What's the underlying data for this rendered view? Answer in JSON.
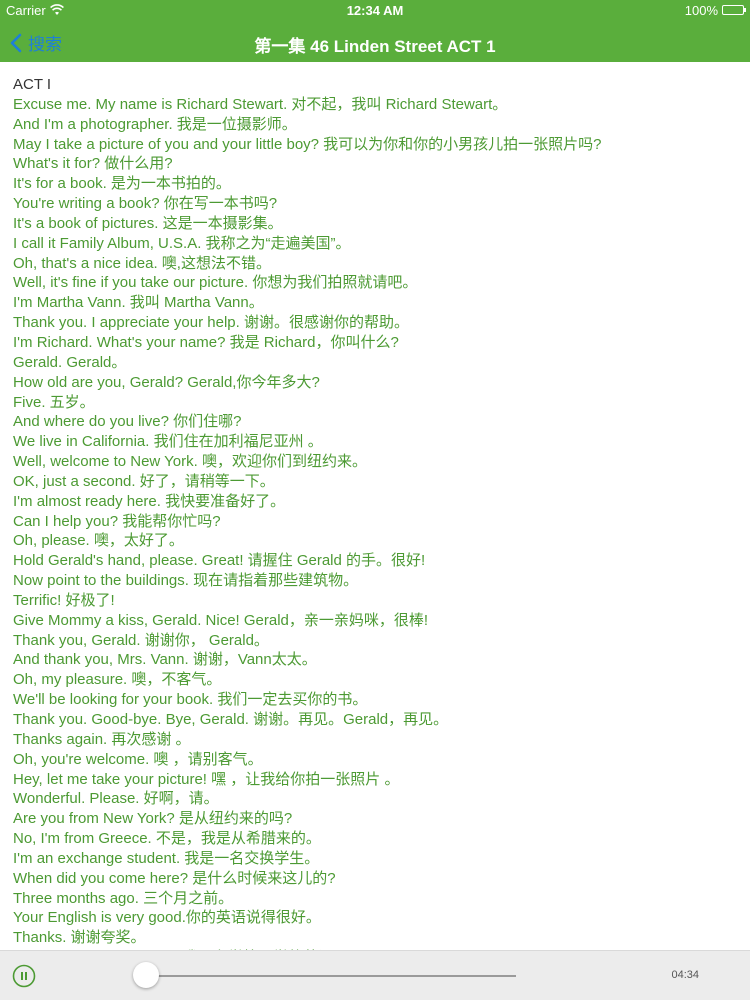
{
  "status_bar": {
    "carrier": "Carrier",
    "time": "12:34 AM",
    "battery": "100%"
  },
  "nav": {
    "back_label": "搜索",
    "title": "第一集 46 Linden Street ACT 1"
  },
  "script_lines": [
    "ACT I",
    "Excuse me. My name is Richard Stewart. 对不起，我叫 Richard Stewart。",
    "And I'm a photographer.  我是一位摄影师。",
    "May I take a picture of you and your little boy?  我可以为你和你的小男孩儿拍一张照片吗?",
    "What's it for?  做什么用?",
    "It's for a book.  是为一本书拍的。",
    "You're writing a book? 你在写一本书吗?",
    "It's a book of pictures. 这是一本摄影集。",
    "I call it Family Album, U.S.A.  我称之为“走遍美国”。",
    "Oh, that's a nice idea.  噢,这想法不错。",
    "Well, it's fine if you take our picture.  你想为我们拍照就请吧。",
    "I'm Martha Vann.  我叫 Martha Vann。",
    "Thank you. I appreciate your help.  谢谢。很感谢你的帮助。",
    "I'm Richard. What's your name?  我是 Richard，你叫什么?",
    "Gerald. Gerald。",
    "How old are you, Gerald? Gerald,你今年多大?",
    "Five.  五岁。",
    "And where do you live? 你们住哪?",
    "We live in California.  我们住在加利福尼亚州  。",
    "Well, welcome to New York.  噢，欢迎你们到纽约来。",
    "OK, just a second.  好了，请稍等一下。",
    "I'm almost ready here.  我快要准备好了。",
    "Can I help you?  我能帮你忙吗?",
    "Oh, please. 噢，太好了。",
    "Hold Gerald's hand, please. Great!  请握住 Gerald 的手。很好!",
    "Now point to the buildings. 现在请指着那些建筑物。",
    "Terrific!  好极了!",
    "Give Mommy a kiss, Gerald. Nice! Gerald，亲一亲妈咪，很棒!",
    "Thank you, Gerald. 谢谢你，  Gerald。",
    "And thank you, Mrs. Vann.  谢谢，Vann太太。",
    "Oh, my pleasure.  噢，不客气。",
    "We'll be looking for your book.  我们一定去买你的书。",
    "Thank you. Good-bye. Bye, Gerald.  谢谢。再见。Gerald，再见。",
    "Thanks again.  再次感谢 。",
    "Oh, you're welcome.  噢 ，请别客气。",
    "Hey, let me take your picture!  嘿 ，让我给你拍一张照片 。",
    "Wonderful. Please.  好啊，请。",
    "Are you from New York? 是从纽约来的吗?",
    "No, I'm from Greece.  不是，我是从希腊来的。",
    "I'm an exchange student.  我是一名交换学生。",
    "When did you come here? 是什么时候来这儿的?",
    "Three months ago.  三个月之前。",
    "Your English is very good.你的英语说得很好。",
    "Thanks.  谢谢夸奖。",
    "I study English at school.  我是在学校里学的英语。"
  ],
  "player": {
    "progress": 0.0,
    "duration": "04:34"
  },
  "colors": {
    "bar_green": "#5aae3c",
    "text_green": "#4c9a33",
    "back_blue": "#1e7fd8"
  }
}
